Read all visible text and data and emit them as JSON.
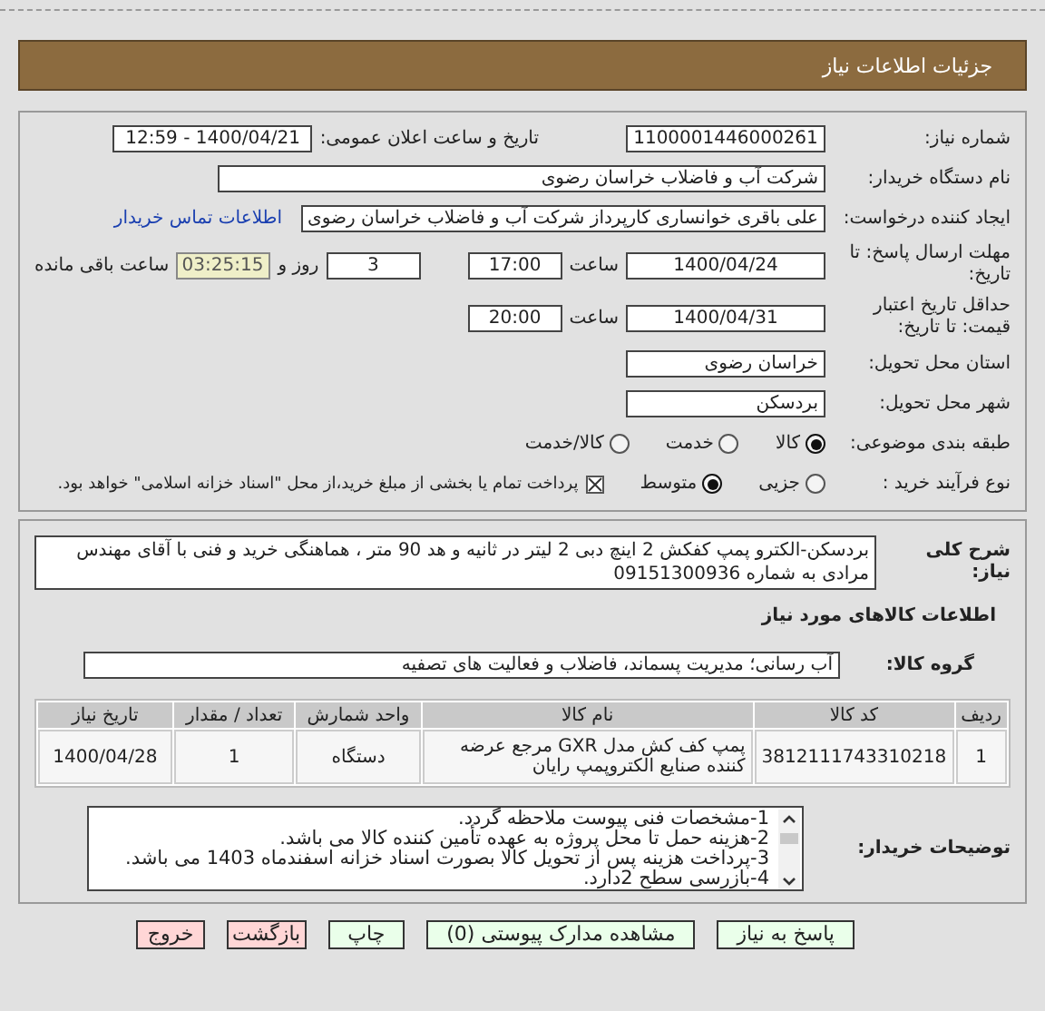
{
  "header": {
    "title": "جزئیات اطلاعات نیاز"
  },
  "details": {
    "need_number": {
      "label": "شماره نیاز:",
      "value": "1100001446000261"
    },
    "announce": {
      "label": "تاریخ و ساعت اعلان عمومی:",
      "value": "1400/04/21 - 12:59"
    },
    "buyer": {
      "label": "نام دستگاه خریدار:",
      "value": "شرکت آب و فاضلاب خراسان رضوی"
    },
    "creator": {
      "label": "ایجاد کننده درخواست:",
      "value": "علی باقری خوانساری کارپرداز شرکت آب و فاضلاب خراسان رضوی",
      "link": "اطلاعات تماس خریدار"
    },
    "deadline": {
      "label": "مهلت ارسال پاسخ: تا تاریخ:",
      "date": "1400/04/24",
      "time_label": "ساعت",
      "time": "17:00",
      "days": "3",
      "days_label": "روز و",
      "remaining": "03:25:15",
      "remaining_label": "ساعت باقی مانده"
    },
    "validity": {
      "label": "حداقل تاریخ اعتبار قیمت: تا تاریخ:",
      "date": "1400/04/31",
      "time_label": "ساعت",
      "time": "20:00"
    },
    "province": {
      "label": "استان محل تحویل:",
      "value": "خراسان رضوی"
    },
    "city": {
      "label": "شهر محل تحویل:",
      "value": "بردسکن"
    },
    "category": {
      "label": "طبقه بندی موضوعی:",
      "options": [
        {
          "label": "کالا",
          "selected": true
        },
        {
          "label": "خدمت",
          "selected": false
        },
        {
          "label": "کالا/خدمت",
          "selected": false
        }
      ]
    },
    "process": {
      "label": "نوع فرآیند خرید :",
      "options": [
        {
          "label": "جزیی",
          "selected": false
        },
        {
          "label": "متوسط",
          "selected": true
        }
      ],
      "payment": {
        "label": "پرداخت تمام یا بخشی از مبلغ خرید،از محل \"اسناد خزانه اسلامی\" خواهد بود.",
        "checked": true
      }
    }
  },
  "need": {
    "description_label": "شرح کلی نیاز:",
    "description": "بردسکن-الکترو پمپ کفکش 2 اینچ دبی 2 لیتر در ثانیه و هد 90 متر ، هماهنگی خرید و فنی با آقای مهندس مرادی به شماره 09151300936",
    "goods_title": "اطلاعات کالاهای مورد نیاز",
    "group_label": "گروه کالا:",
    "group": "آب رسانی؛ مدیریت پسماند، فاضلاب و فعالیت های تصفیه",
    "table": {
      "columns": [
        "ردیف",
        "کد کالا",
        "نام کالا",
        "واحد شمارش",
        "تعداد / مقدار",
        "تاریخ نیاز"
      ],
      "rows": [
        [
          "1",
          "3812111743310218",
          "پمپ کف کش مدل GXR مرجع عرضه کننده صنایع الکتروپمپ رایان",
          "دستگاه",
          "1",
          "1400/04/28"
        ]
      ]
    },
    "notes_label": "توضیحات خریدار:",
    "notes": [
      "1-مشخصات فنی پیوست ملاحظه گردد.",
      "2-هزینه حمل تا محل پروژه به عهده تأمین کننده کالا می باشد.",
      "3-پرداخت هزینه پس از تحویل کالا بصورت اسناد خزانه اسفندماه 1403 می باشد.",
      "4-بازرسی سطح 2دارد."
    ]
  },
  "buttons": [
    {
      "label": "پاسخ به نیاز",
      "kind": "action"
    },
    {
      "label": "مشاهده مدارک پیوستی (0)",
      "kind": "action"
    },
    {
      "label": "چاپ",
      "kind": "action"
    },
    {
      "label": "بازگشت",
      "kind": "leave"
    },
    {
      "label": "خروج",
      "kind": "leave"
    }
  ]
}
